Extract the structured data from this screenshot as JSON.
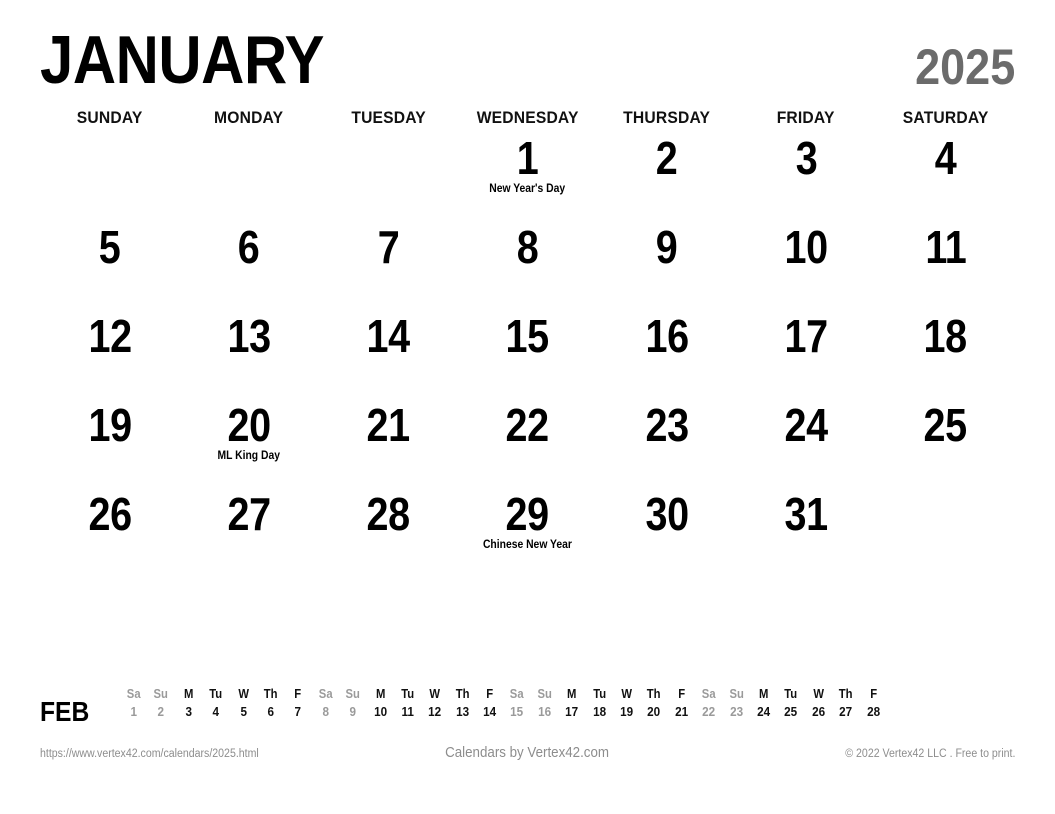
{
  "header": {
    "month": "JANUARY",
    "year": "2025"
  },
  "weekday_headers": [
    "SUNDAY",
    "MONDAY",
    "TUESDAY",
    "WEDNESDAY",
    "THURSDAY",
    "FRIDAY",
    "SATURDAY"
  ],
  "weeks": [
    [
      {
        "day": "",
        "event": ""
      },
      {
        "day": "",
        "event": ""
      },
      {
        "day": "",
        "event": ""
      },
      {
        "day": "1",
        "event": "New Year's Day"
      },
      {
        "day": "2",
        "event": ""
      },
      {
        "day": "3",
        "event": ""
      },
      {
        "day": "4",
        "event": ""
      }
    ],
    [
      {
        "day": "5",
        "event": ""
      },
      {
        "day": "6",
        "event": ""
      },
      {
        "day": "7",
        "event": ""
      },
      {
        "day": "8",
        "event": ""
      },
      {
        "day": "9",
        "event": ""
      },
      {
        "day": "10",
        "event": ""
      },
      {
        "day": "11",
        "event": ""
      }
    ],
    [
      {
        "day": "12",
        "event": ""
      },
      {
        "day": "13",
        "event": ""
      },
      {
        "day": "14",
        "event": ""
      },
      {
        "day": "15",
        "event": ""
      },
      {
        "day": "16",
        "event": ""
      },
      {
        "day": "17",
        "event": ""
      },
      {
        "day": "18",
        "event": ""
      }
    ],
    [
      {
        "day": "19",
        "event": ""
      },
      {
        "day": "20",
        "event": "ML King Day"
      },
      {
        "day": "21",
        "event": ""
      },
      {
        "day": "22",
        "event": ""
      },
      {
        "day": "23",
        "event": ""
      },
      {
        "day": "24",
        "event": ""
      },
      {
        "day": "25",
        "event": ""
      }
    ],
    [
      {
        "day": "26",
        "event": ""
      },
      {
        "day": "27",
        "event": ""
      },
      {
        "day": "28",
        "event": ""
      },
      {
        "day": "29",
        "event": "Chinese New Year"
      },
      {
        "day": "30",
        "event": ""
      },
      {
        "day": "31",
        "event": ""
      },
      {
        "day": "",
        "event": ""
      }
    ]
  ],
  "next_month_strip": {
    "label": "FEB",
    "days": [
      {
        "dow": "Sa",
        "num": "1",
        "type": "weekend"
      },
      {
        "dow": "Su",
        "num": "2",
        "type": "weekend"
      },
      {
        "dow": "M",
        "num": "3",
        "type": "weekday"
      },
      {
        "dow": "Tu",
        "num": "4",
        "type": "weekday"
      },
      {
        "dow": "W",
        "num": "5",
        "type": "weekday"
      },
      {
        "dow": "Th",
        "num": "6",
        "type": "weekday"
      },
      {
        "dow": "F",
        "num": "7",
        "type": "weekday"
      },
      {
        "dow": "Sa",
        "num": "8",
        "type": "weekend"
      },
      {
        "dow": "Su",
        "num": "9",
        "type": "weekend"
      },
      {
        "dow": "M",
        "num": "10",
        "type": "weekday"
      },
      {
        "dow": "Tu",
        "num": "11",
        "type": "weekday"
      },
      {
        "dow": "W",
        "num": "12",
        "type": "weekday"
      },
      {
        "dow": "Th",
        "num": "13",
        "type": "weekday"
      },
      {
        "dow": "F",
        "num": "14",
        "type": "weekday"
      },
      {
        "dow": "Sa",
        "num": "15",
        "type": "weekend"
      },
      {
        "dow": "Su",
        "num": "16",
        "type": "weekend"
      },
      {
        "dow": "M",
        "num": "17",
        "type": "weekday"
      },
      {
        "dow": "Tu",
        "num": "18",
        "type": "weekday"
      },
      {
        "dow": "W",
        "num": "19",
        "type": "weekday"
      },
      {
        "dow": "Th",
        "num": "20",
        "type": "weekday"
      },
      {
        "dow": "F",
        "num": "21",
        "type": "weekday"
      },
      {
        "dow": "Sa",
        "num": "22",
        "type": "weekend"
      },
      {
        "dow": "Su",
        "num": "23",
        "type": "weekend"
      },
      {
        "dow": "M",
        "num": "24",
        "type": "weekday"
      },
      {
        "dow": "Tu",
        "num": "25",
        "type": "weekday"
      },
      {
        "dow": "W",
        "num": "26",
        "type": "weekday"
      },
      {
        "dow": "Th",
        "num": "27",
        "type": "weekday"
      },
      {
        "dow": "F",
        "num": "28",
        "type": "weekday"
      }
    ]
  },
  "footer": {
    "url": "https://www.vertex42.com/calendars/2025.html",
    "credit": "Calendars by Vertex42.com",
    "copyright": "© 2022 Vertex42 LLC . Free to print."
  },
  "colors": {
    "text": "#000000",
    "year": "#6b6b6b",
    "muted": "#9a9a9a",
    "footer": "#8d8d8d",
    "background": "#ffffff"
  }
}
